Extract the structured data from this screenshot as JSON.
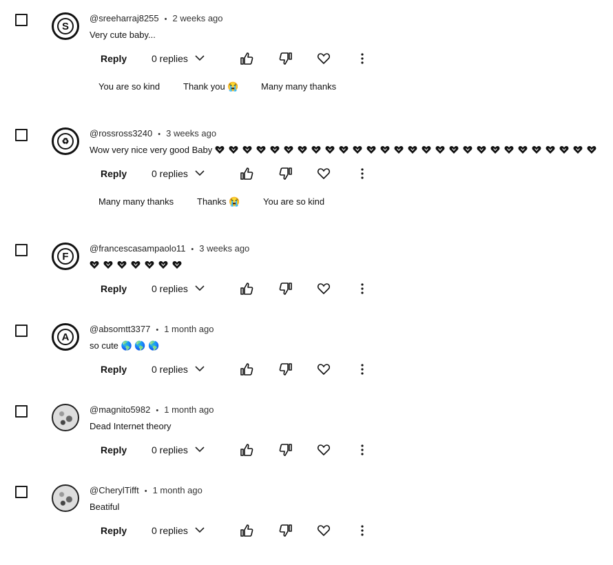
{
  "actions": {
    "reply_label": "Reply",
    "like_icon": "thumbs-up-icon",
    "dislike_icon": "thumbs-down-icon",
    "heart_icon": "heart-icon",
    "more_icon": "more-vert-icon"
  },
  "comments": [
    {
      "handle": "@sreeharraj8255",
      "time": "2 weeks ago",
      "avatar_letter": "S",
      "text": "Very cute baby...",
      "replies": "0 replies",
      "suggestions": [
        "You are so kind",
        "Thank you 😭",
        "Many many thanks"
      ]
    },
    {
      "handle": "@rossross3240",
      "time": "3 weeks ago",
      "avatar_letter": "♻",
      "text": "Wow very nice very good Baby",
      "heart_count": 28,
      "replies": "0 replies",
      "suggestions": [
        "Many many thanks",
        "Thanks 😭",
        "You are so kind"
      ]
    },
    {
      "handle": "@francescasampaolo11",
      "time": "3 weeks ago",
      "avatar_letter": "F",
      "text": "",
      "heart_count": 7,
      "replies": "0 replies"
    },
    {
      "handle": "@absomtt3377",
      "time": "1 month ago",
      "avatar_letter": "A",
      "text": "so cute 🌎 🌎 🌎",
      "replies": "0 replies"
    },
    {
      "handle": "@magnito5982",
      "time": "1 month ago",
      "avatar_letter": "",
      "text": "Dead Internet theory",
      "replies": "0 replies"
    },
    {
      "handle": "@CherylTifft",
      "time": "1 month ago",
      "avatar_letter": "",
      "text": "Beatiful",
      "replies": "0 replies"
    }
  ]
}
